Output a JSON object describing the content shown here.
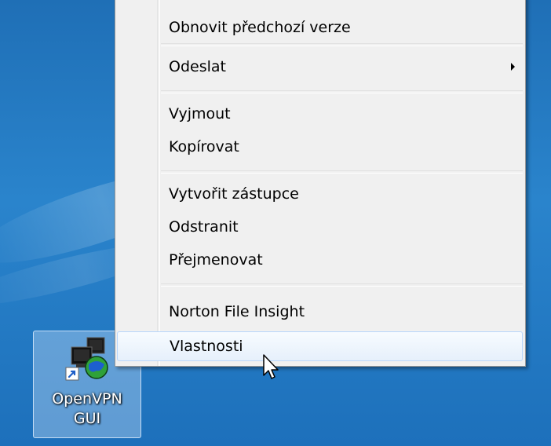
{
  "context_menu": {
    "items": [
      {
        "label": "Obnovit předchozí verze"
      },
      {
        "label": "Odeslat",
        "has_submenu": true
      },
      {
        "label": "Vyjmout"
      },
      {
        "label": "Kopírovat"
      },
      {
        "label": "Vytvořit zástupce"
      },
      {
        "label": "Odstranit"
      },
      {
        "label": "Přejmenovat"
      },
      {
        "label": "Norton File Insight"
      },
      {
        "label": "Vlastnosti",
        "highlighted": true
      }
    ],
    "highlight_color": "#b8d6fb"
  },
  "desktop": {
    "background_color": "#1f6fb6",
    "icon": {
      "label_line1": "OpenVPN",
      "label_line2": "GUI",
      "icon_name": "openvpn-gui-shortcut-icon",
      "selected": true
    }
  },
  "cursor": {
    "icon_name": "arrow-cursor-icon"
  }
}
